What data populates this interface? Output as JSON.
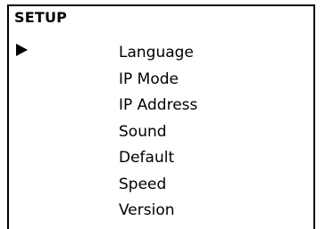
{
  "screen": {
    "title": "SETUP"
  },
  "menu": {
    "selected_index": 0,
    "items": [
      {
        "label": "Language"
      },
      {
        "label": "IP Mode"
      },
      {
        "label": "IP Address"
      },
      {
        "label": "Sound"
      },
      {
        "label": "Default"
      },
      {
        "label": "Speed"
      },
      {
        "label": "Version"
      }
    ]
  },
  "icons": {
    "cursor": "triangle-right-icon"
  }
}
